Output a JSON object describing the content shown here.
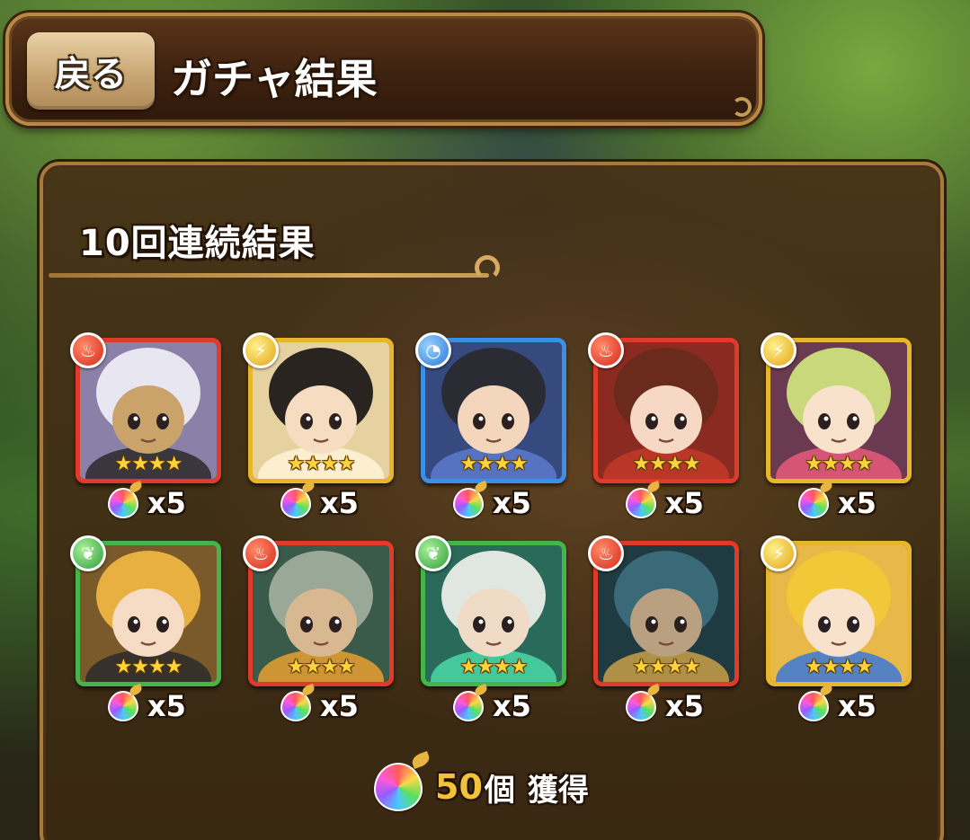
{
  "header": {
    "back_label": "戻る",
    "title": "ガチャ結果"
  },
  "panel": {
    "title": "10回連続結果"
  },
  "results": [
    {
      "attribute": "fire",
      "stars": "★★★★",
      "reward": "x5",
      "palette": {
        "hair": "#e8e6f0",
        "skin": "#c9a36a",
        "bg": "#8a80a8",
        "accent": "#2a2a2a"
      }
    },
    {
      "attribute": "light",
      "stars": "★★★★",
      "reward": "x5",
      "palette": {
        "hair": "#2a2420",
        "skin": "#f6dcc0",
        "bg": "#e6d2a0",
        "accent": "#fff4d8"
      }
    },
    {
      "attribute": "water",
      "stars": "★★★★",
      "reward": "x5",
      "palette": {
        "hair": "#2b2b33",
        "skin": "#f4d6bc",
        "bg": "#364a80",
        "accent": "#5a7acb"
      }
    },
    {
      "attribute": "fire",
      "stars": "★★★★",
      "reward": "x5",
      "palette": {
        "hair": "#6a2a1c",
        "skin": "#f6d8c4",
        "bg": "#8a2a20",
        "accent": "#c23a2a"
      }
    },
    {
      "attribute": "light",
      "stars": "★★★★",
      "reward": "x5",
      "palette": {
        "hair": "#c9d87a",
        "skin": "#f8e2cc",
        "bg": "#6a3a50",
        "accent": "#e85a7a"
      }
    },
    {
      "attribute": "wood",
      "stars": "★★★★",
      "reward": "x5",
      "palette": {
        "hair": "#e8b040",
        "skin": "#f6dcc4",
        "bg": "#7a5a2a",
        "accent": "#2a2a2a"
      }
    },
    {
      "attribute": "fire",
      "stars": "★★★★",
      "reward": "x5",
      "palette": {
        "hair": "#9aa898",
        "skin": "#d8b890",
        "bg": "#3a5a4a",
        "accent": "#e8a030"
      }
    },
    {
      "attribute": "wood",
      "stars": "★★★★",
      "reward": "x5",
      "palette": {
        "hair": "#e0e6e0",
        "skin": "#f0dcc6",
        "bg": "#2a6a5a",
        "accent": "#4ad8a8"
      }
    },
    {
      "attribute": "fire",
      "stars": "★★★★",
      "reward": "x5",
      "palette": {
        "hair": "#3a6a78",
        "skin": "#b8a080",
        "bg": "#1f3a40",
        "accent": "#c8a048"
      }
    },
    {
      "attribute": "light",
      "stars": "★★★★",
      "reward": "x5",
      "palette": {
        "hair": "#f0c838",
        "skin": "#f8e2cc",
        "bg": "#e8b848",
        "accent": "#3a78d8"
      }
    }
  ],
  "total": {
    "count": "50",
    "unit": "個",
    "label": "獲得"
  },
  "colors": {
    "fire": "#e03b2a",
    "light": "#e8b62c",
    "water": "#3b8fe6",
    "wood": "#45b54a",
    "panel": "#3d2a12",
    "gold_text": "#f2c33a"
  },
  "icons": {
    "attribute_fire": "flame-orb-icon",
    "attribute_light": "lightning-orb-icon",
    "attribute_water": "water-drop-orb-icon",
    "attribute_wood": "leaf-orb-icon",
    "reward_item": "rainbow-fruit-icon"
  }
}
